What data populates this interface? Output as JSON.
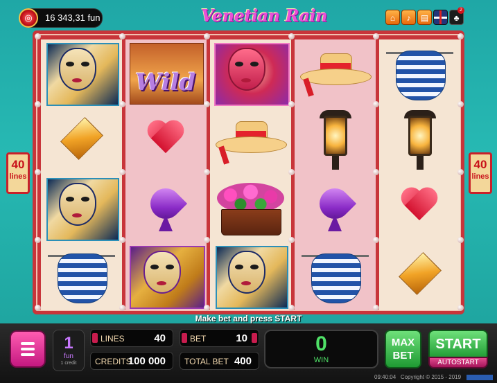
{
  "header": {
    "balance": "16 343,31 fun",
    "game_title": "Venetian Rain",
    "notification_count": "2",
    "icons": [
      "home-icon",
      "sound-icon",
      "info-icon",
      "language-flag-icon",
      "settings-icon"
    ]
  },
  "lines_badge": {
    "value": "40",
    "label": "lines"
  },
  "reels": [
    [
      "blue-mask",
      "diamond",
      "blue-mask",
      "striped-shirt"
    ],
    [
      "wild",
      "heart",
      "spade",
      "gold-mask"
    ],
    [
      "red-mask",
      "straw-hat",
      "flower-pot",
      "blue-mask"
    ],
    [
      "straw-hat",
      "lantern",
      "spade",
      "striped-shirt"
    ],
    [
      "striped-shirt",
      "lantern",
      "heart",
      "diamond"
    ]
  ],
  "wild_label": "Wild",
  "message": "Make bet and press START",
  "controls": {
    "coin_value": "1",
    "coin_unit": "fun",
    "coin_sub": "1 credit",
    "lines_label": "LINES",
    "lines_value": "40",
    "bet_label": "BET",
    "bet_value": "10",
    "credits_label": "CREDITS",
    "credits_value": "100 000",
    "total_bet_label": "TOTAL BET",
    "total_bet_value": "400",
    "win_value": "0",
    "win_label": "WIN",
    "maxbet_line1": "MAX",
    "maxbet_line2": "BET",
    "start_label": "START",
    "autostart_label": "AUTOSTART"
  },
  "footer": {
    "time": "09:40:04",
    "copyright": "Copyright © 2015 - 2019"
  },
  "colors": {
    "frame": "#c8353a",
    "accent_green": "#4fe067",
    "menu_pink": "#c41880"
  }
}
